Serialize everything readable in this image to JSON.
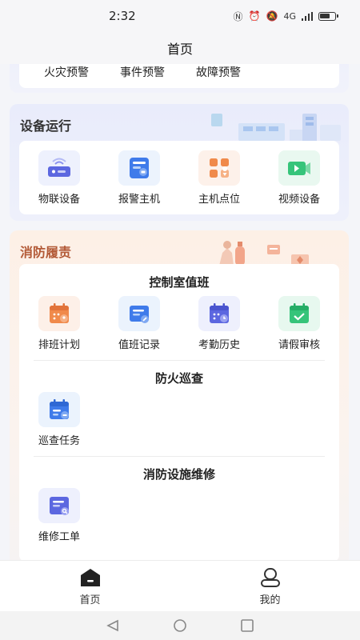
{
  "status_bar": {
    "time": "2:32",
    "network": "4G"
  },
  "nav": {
    "title": "首页"
  },
  "alerts": {
    "items": [
      "火灾预警",
      "事件预警",
      "故障预警"
    ]
  },
  "device_section": {
    "title": "设备运行",
    "items": [
      {
        "label": "物联设备",
        "icon": "iot-device-icon"
      },
      {
        "label": "报警主机",
        "icon": "alarm-host-icon"
      },
      {
        "label": "主机点位",
        "icon": "host-point-icon"
      },
      {
        "label": "视频设备",
        "icon": "video-device-icon"
      }
    ]
  },
  "duty_section": {
    "title": "消防履责",
    "control_room": {
      "title": "控制室值班",
      "items": [
        {
          "label": "排班计划",
          "icon": "schedule-plan-icon"
        },
        {
          "label": "值班记录",
          "icon": "duty-record-icon"
        },
        {
          "label": "考勤历史",
          "icon": "attendance-history-icon"
        },
        {
          "label": "请假审核",
          "icon": "leave-review-icon"
        }
      ]
    },
    "patrol": {
      "title": "防火巡查",
      "items": [
        {
          "label": "巡查任务",
          "icon": "patrol-task-icon"
        }
      ]
    },
    "maintenance": {
      "title": "消防设施维修",
      "items": [
        {
          "label": "维修工单",
          "icon": "repair-order-icon"
        }
      ]
    }
  },
  "tab_bar": {
    "tabs": [
      {
        "label": "首页",
        "icon": "home-icon"
      },
      {
        "label": "我的",
        "icon": "profile-icon"
      }
    ]
  },
  "colors": {
    "orange": "#f08a4b",
    "blue": "#3f7bea",
    "indigo": "#5c67e0",
    "green": "#36c47a"
  }
}
